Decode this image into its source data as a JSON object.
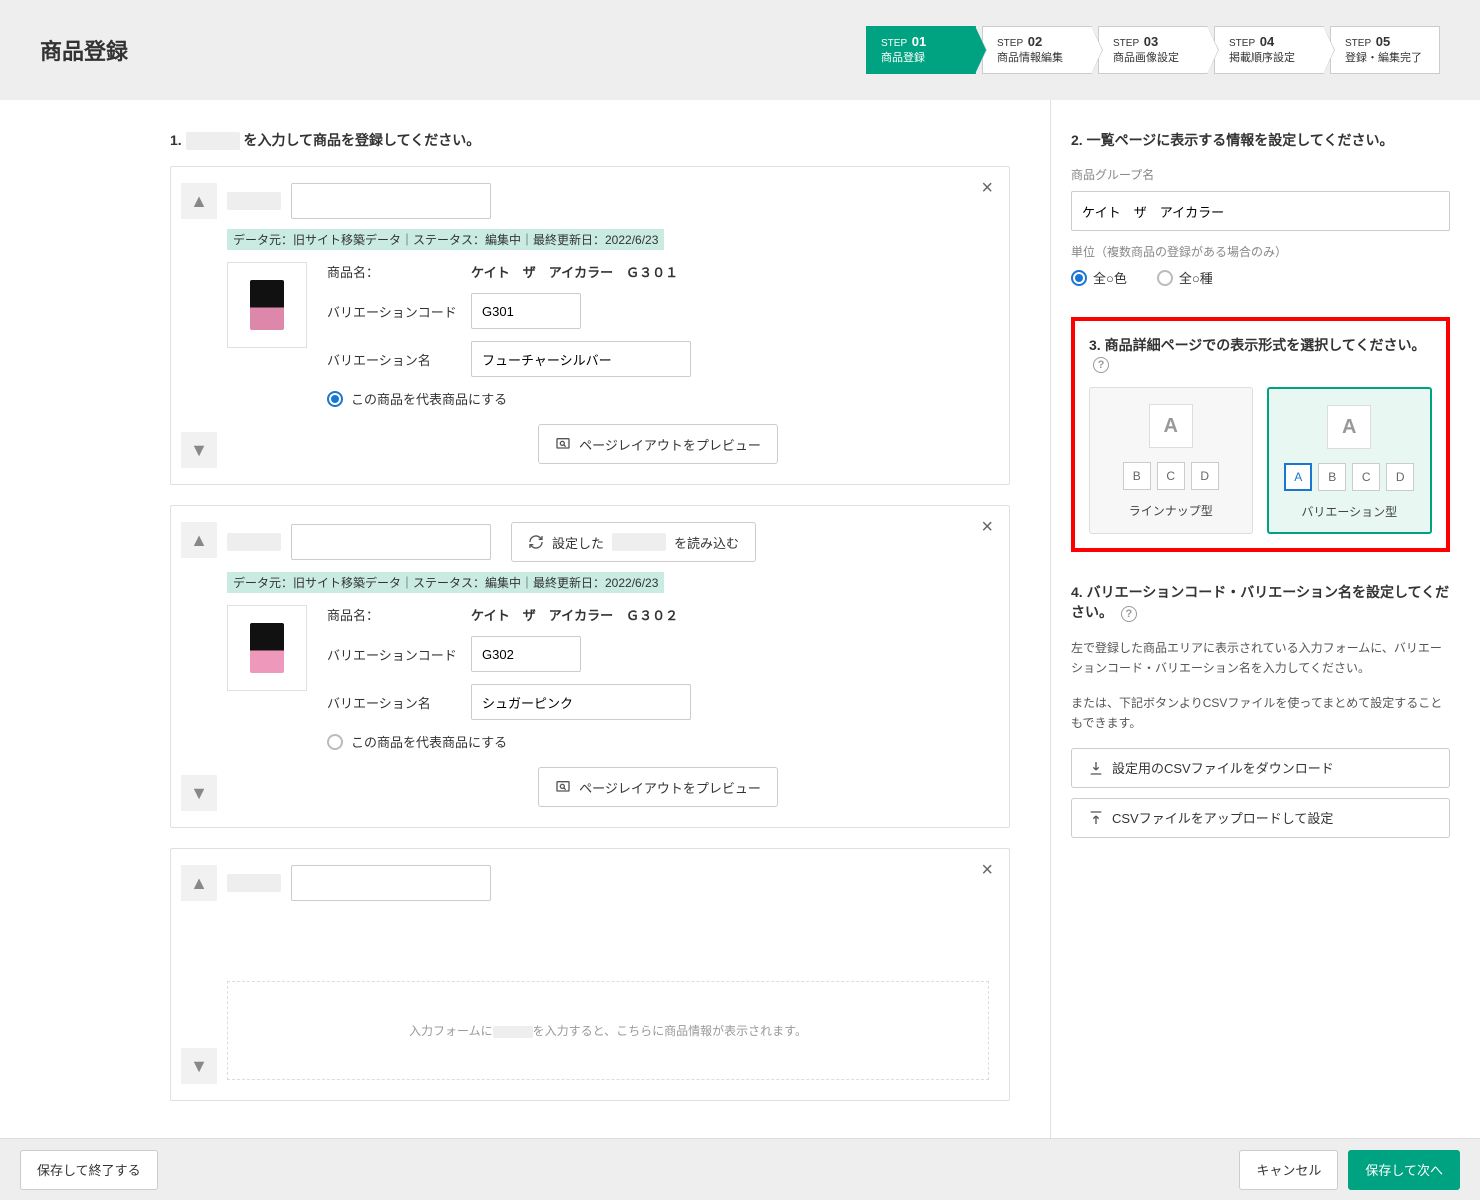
{
  "header": {
    "title": "商品登録",
    "steps": [
      {
        "no": "01",
        "label": "商品登録",
        "active": true
      },
      {
        "no": "02",
        "label": "商品情報編集",
        "active": false
      },
      {
        "no": "03",
        "label": "商品画像設定",
        "active": false
      },
      {
        "no": "04",
        "label": "掲載順序設定",
        "active": false
      },
      {
        "no": "05",
        "label": "登録・編集完了",
        "active": false
      }
    ],
    "step_prefix": "STEP"
  },
  "left": {
    "section1_num": "1.",
    "section1_tail": "を入力して商品を登録してください。",
    "meta": "データ元：旧サイト移築データ｜ステータス：編集中｜最終更新日：2022/6/23",
    "labels": {
      "product_name": "商品名：",
      "variation_code": "バリエーションコード",
      "variation_name": "バリエーション名",
      "represent": "この商品を代表商品にする",
      "preview": "ページレイアウトをプレビュー",
      "reload_pre": "設定した",
      "reload_post": "を読み込む"
    },
    "products": [
      {
        "name": "ケイト　ザ　アイカラー　Ｇ３０１",
        "code": "G301",
        "vname": "フューチャーシルバー",
        "represent": true,
        "has_reload": false
      },
      {
        "name": "ケイト　ザ　アイカラー　Ｇ３０２",
        "code": "G302",
        "vname": "シュガーピンク",
        "represent": false,
        "has_reload": true
      }
    ],
    "placeholder_msg_pre": "入力フォームに",
    "placeholder_msg_post": "を入力すると、こちらに商品情報が表示されます。"
  },
  "right": {
    "sec2": {
      "title": "2. 一覧ページに表示する情報を設定してください。",
      "group_label": "商品グループ名",
      "group_value": "ケイト　ザ　アイカラー",
      "unit_label": "単位（複数商品の登録がある場合のみ）",
      "unit_opts": [
        "全○色",
        "全○種"
      ]
    },
    "sec3": {
      "title": "3. 商品詳細ページでの表示形式を選択してください。",
      "opts": [
        {
          "name": "ラインナップ型",
          "chips": [
            "B",
            "C",
            "D"
          ],
          "selected": false
        },
        {
          "name": "バリエーション型",
          "chips": [
            "A",
            "B",
            "C",
            "D"
          ],
          "selected": true
        }
      ]
    },
    "sec4": {
      "title": "4. バリエーションコード・バリエーション名を設定してください。",
      "desc1": "左で登録した商品エリアに表示されている入力フォームに、バリエーションコード・バリエーション名を入力してください。",
      "desc2": "または、下記ボタンよりCSVファイルを使ってまとめて設定することもできます。",
      "btn_dl": "設定用のCSVファイルをダウンロード",
      "btn_ul": "CSVファイルをアップロードして設定"
    }
  },
  "footer": {
    "save_exit": "保存して終了する",
    "cancel": "キャンセル",
    "next": "保存して次へ"
  }
}
